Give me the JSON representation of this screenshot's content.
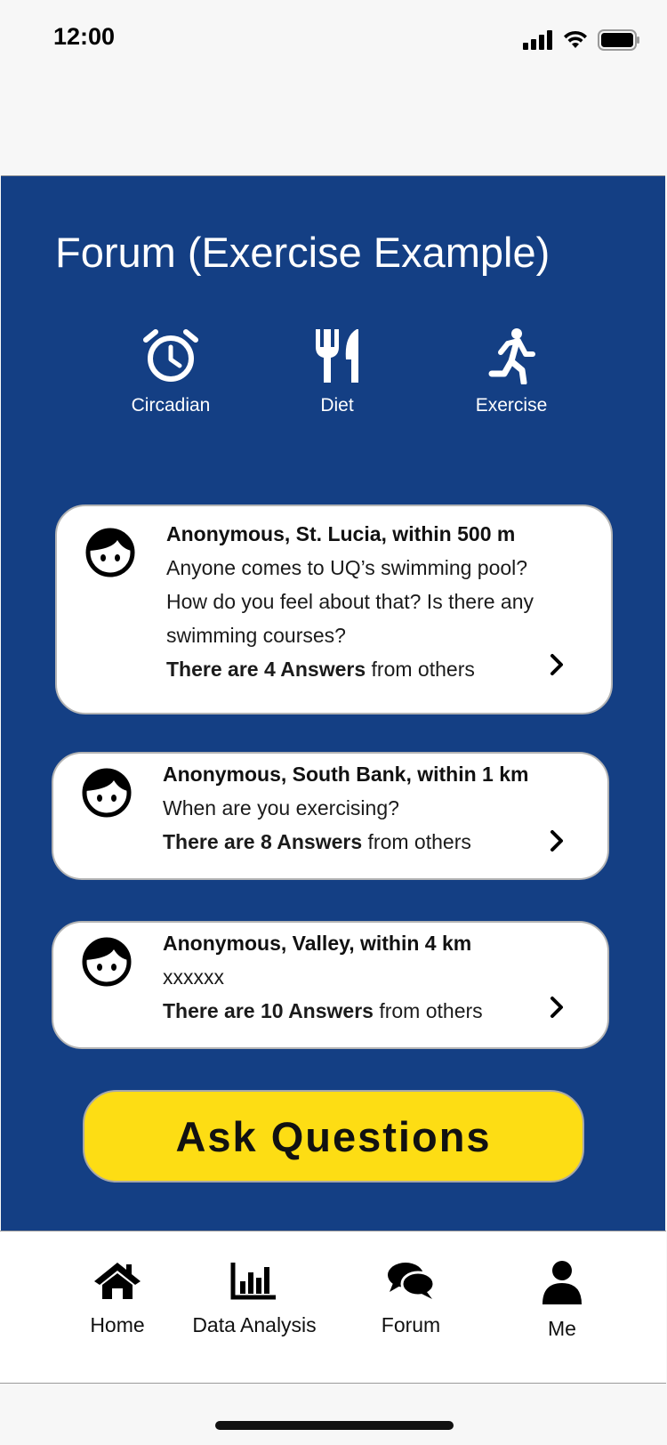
{
  "status": {
    "time": "12:00"
  },
  "page": {
    "title": "Forum (Exercise Example)"
  },
  "categories": [
    {
      "label": "Circadian",
      "icon": "alarm-clock-icon"
    },
    {
      "label": "Diet",
      "icon": "utensils-icon"
    },
    {
      "label": "Exercise",
      "icon": "running-person-icon"
    }
  ],
  "posts": [
    {
      "author": "Anonymous, St. Lucia, within 500 m",
      "lines": [
        "Anyone comes to UQ’s swimming pool?",
        "How do you feel about that? Is there any",
        "swimming courses?"
      ],
      "answers_bold": "There are 4 Answers",
      "answers_rest": " from others"
    },
    {
      "author": "Anonymous, South Bank, within 1 km",
      "lines": [
        "When are you exercising?"
      ],
      "answers_bold": "There are 8 Answers",
      "answers_rest": " from others"
    },
    {
      "author": "Anonymous, Valley, within 4 km",
      "lines": [
        "xxxxxx"
      ],
      "answers_bold": "There are 10 Answers",
      "answers_rest": " from others"
    }
  ],
  "ask_button": {
    "label": "Ask Questions"
  },
  "tabs": [
    {
      "label": "Home",
      "icon": "home-icon"
    },
    {
      "label": "Data Analysis",
      "icon": "bar-chart-icon"
    },
    {
      "label": "Forum",
      "icon": "chat-bubbles-icon"
    },
    {
      "label": "Me",
      "icon": "user-icon"
    }
  ],
  "colors": {
    "primary_blue": "#143f84",
    "accent_yellow": "#fddd14",
    "card_white": "#ffffff",
    "text_dark": "#111111"
  }
}
